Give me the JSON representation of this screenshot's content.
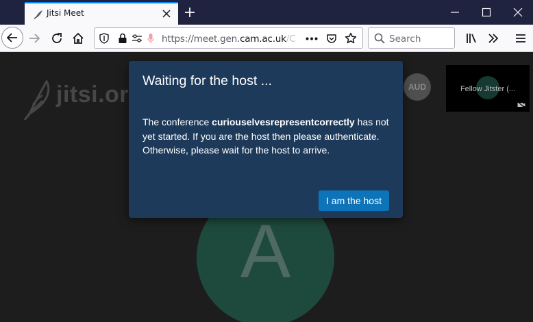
{
  "browser": {
    "tab_title": "Jitsi Meet",
    "url_prefix": "https://meet.gen.",
    "url_domain": "cam.ac.uk",
    "url_rest": "/C",
    "search_placeholder": "Search",
    "icons": [
      "jitsi-favicon",
      "close-icon",
      "plus-icon",
      "minimize-icon",
      "maximize-icon",
      "window-close-icon",
      "back-icon",
      "forward-icon",
      "reload-icon",
      "home-icon",
      "shield-icon",
      "lock-icon",
      "permissions-icon",
      "microphone-icon",
      "more-icon",
      "pocket-icon",
      "star-icon",
      "search-icon",
      "library-icon",
      "overflow-icon",
      "menu-icon"
    ]
  },
  "page": {
    "watermark": "jitsi.org",
    "avatar_letter": "A",
    "audio_badge": "AUD",
    "thumbnail_name": "Fellow Jitster (...",
    "colors": {
      "background": "#1d1d1d",
      "avatar": "#1e4a3e"
    }
  },
  "dialog": {
    "title": "Waiting for the host ...",
    "body_before": "The conference ",
    "conference_name": "curiouselvesrepresentcorrectly",
    "body_after": " has not yet started. If you are the host then please authenticate. Otherwise, please wait for the host to arrive.",
    "button_label": "I am the host",
    "colors": {
      "background": "#1d3a5b",
      "button": "#0e74b9"
    }
  }
}
